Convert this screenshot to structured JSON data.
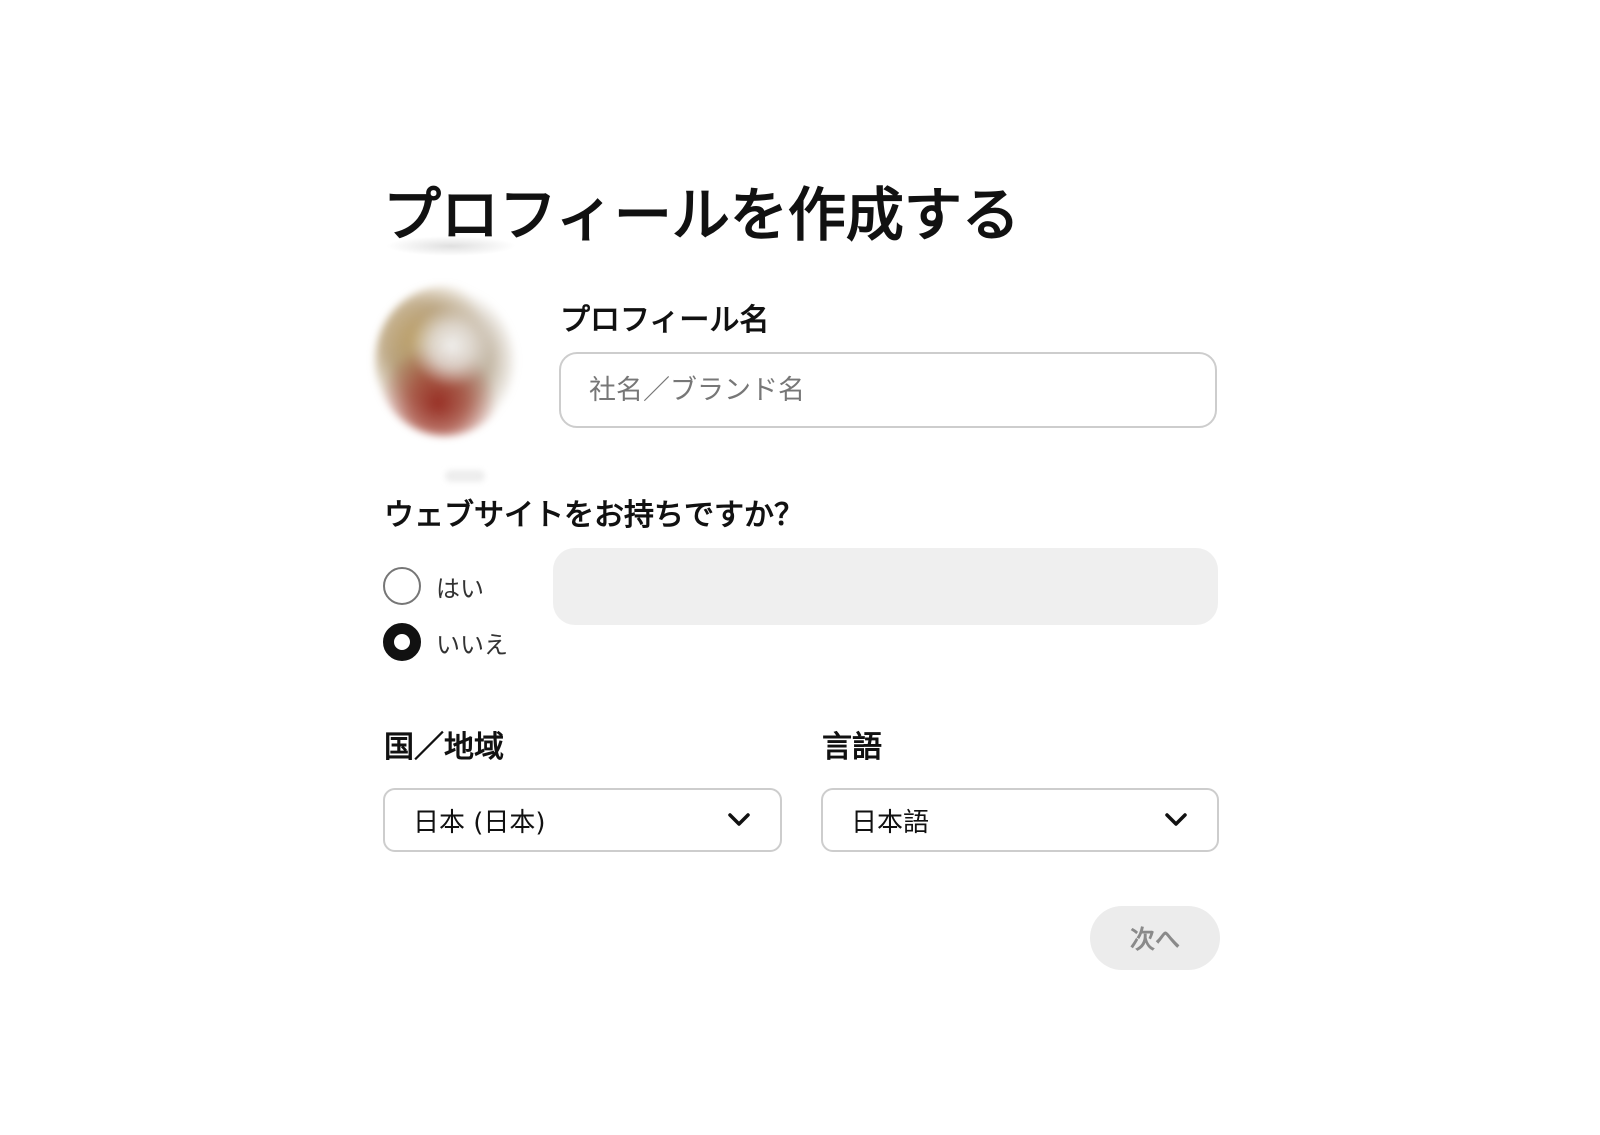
{
  "page": {
    "title": "プロフィールを作成する"
  },
  "profile": {
    "name_label": "プロフィール名",
    "name_value": "",
    "name_placeholder": "社名／ブランド名"
  },
  "website": {
    "question": "ウェブサイトをお持ちですか？",
    "options": [
      {
        "label": "はい",
        "selected": false
      },
      {
        "label": "いいえ",
        "selected": true
      }
    ],
    "url_value": "",
    "url_disabled": true
  },
  "country": {
    "label": "国／地域",
    "selected": "日本 (日本)",
    "icon": "chevron-down-icon"
  },
  "language": {
    "label": "言語",
    "selected": "日本語",
    "icon": "chevron-down-icon"
  },
  "actions": {
    "next_label": "次へ",
    "next_disabled": true
  },
  "colors": {
    "text": "#111111",
    "input_border": "#cdcdcd",
    "disabled_fill": "#efefef",
    "button_disabled_bg": "#ececec",
    "button_disabled_text": "#8a8a8a"
  }
}
